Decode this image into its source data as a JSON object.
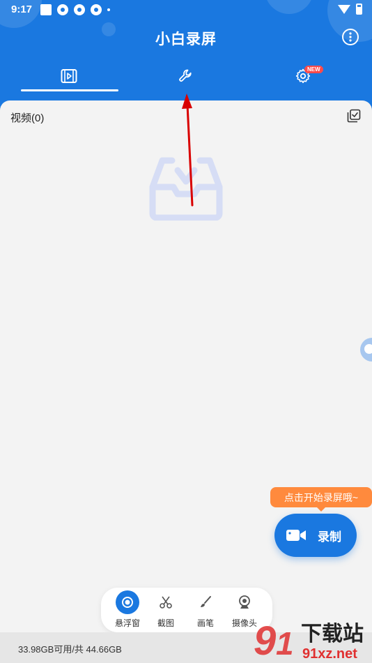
{
  "status_bar": {
    "time": "9:17"
  },
  "header": {
    "title": "小白录屏",
    "tabs": [
      {
        "icon": "video-list-icon",
        "selected": true
      },
      {
        "icon": "wrench-icon",
        "selected": false
      },
      {
        "icon": "settings-gear-icon",
        "selected": false,
        "badge": "NEW"
      }
    ]
  },
  "content": {
    "list_title": "视频(0)",
    "empty_state_icon": "empty-inbox-icon"
  },
  "tooltip": "点击开始录屏哦~",
  "record_button": {
    "label": "录制",
    "icon": "video-camera-icon"
  },
  "toolbar": {
    "items": [
      {
        "label": "悬浮窗",
        "icon": "floating-window-icon",
        "active": true
      },
      {
        "label": "截图",
        "icon": "scissors-icon",
        "active": false
      },
      {
        "label": "画笔",
        "icon": "brush-icon",
        "active": false
      },
      {
        "label": "摄像头",
        "icon": "webcam-icon",
        "active": false
      }
    ]
  },
  "storage": {
    "text": "33.98GB可用/共 44.66GB"
  },
  "watermark": {
    "brand": "下载站",
    "domain": "91xz.net"
  },
  "colors": {
    "primary": "#1a78e0",
    "accent": "#ff8a3d",
    "badge": "#ff4a4a",
    "annotation_arrow": "#d90000"
  }
}
